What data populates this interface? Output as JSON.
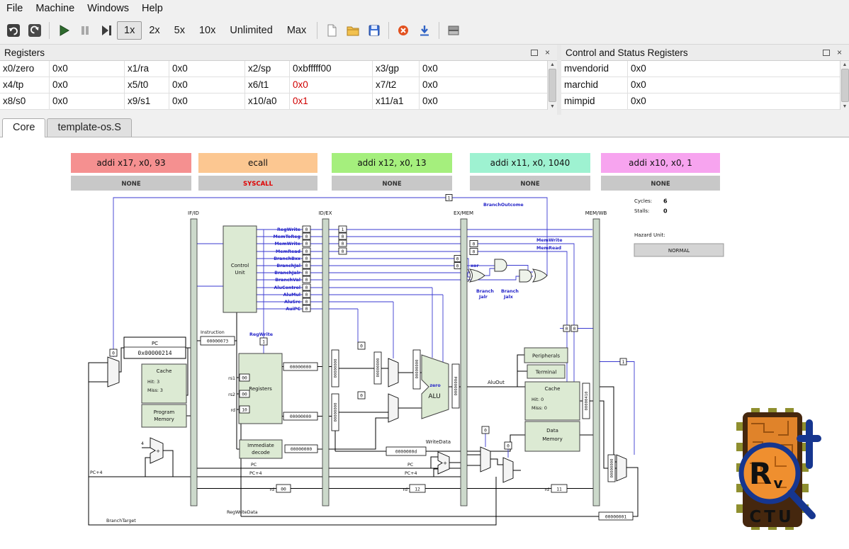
{
  "colors": {
    "accent_blue": "#2626c9",
    "changed_value_red": "#d00000",
    "instr1": "#f59090",
    "instr2": "#fcc791",
    "instr3": "#a5ef7d",
    "instr4": "#9ef2d1",
    "instr5": "#f7a4ef",
    "status_bar_gray": "#c8c8c8",
    "component_green": "#dcead3"
  },
  "menubar": {
    "items": {
      "file": "File",
      "machine": "Machine",
      "windows": "Windows",
      "help": "Help"
    }
  },
  "toolbar": {
    "speeds": {
      "s1": "1x",
      "s2": "2x",
      "s3": "5x",
      "s4": "10x",
      "s5": "Unlimited",
      "s6": "Max"
    },
    "icons": {
      "reset": "reset-icon",
      "reload": "reload-icon",
      "play": "play-icon",
      "pause": "pause-icon",
      "step": "step-icon",
      "new_file": "new-file-icon",
      "open": "open-folder-icon",
      "save": "save-icon",
      "close_sim": "close-icon",
      "fetch": "download-icon",
      "memory": "package-icon"
    }
  },
  "registers_panel": {
    "title": "Registers",
    "rows": [
      [
        "x0/zero",
        "0x0",
        "x1/ra",
        "0x0",
        "x2/sp",
        "0xbfffff00",
        "x3/gp",
        "0x0"
      ],
      [
        "x4/tp",
        "0x0",
        "x5/t0",
        "0x0",
        "x6/t1",
        "0x0",
        "x7/t2",
        "0x0"
      ],
      [
        "x8/s0",
        "0x0",
        "x9/s1",
        "0x0",
        "x10/a0",
        "0x1",
        "x11/a1",
        "0x0"
      ]
    ]
  },
  "csr_panel": {
    "title": "Control and Status Registers",
    "rows": [
      [
        "mvendorid",
        "0x0"
      ],
      [
        "marchid",
        "0x0"
      ],
      [
        "mimpid",
        "0x0"
      ]
    ]
  },
  "tabs": {
    "core": "Core",
    "source": "template-os.S"
  },
  "core": {
    "instructions": [
      {
        "text": "addi x17, x0, 93",
        "status": "NONE"
      },
      {
        "text": "ecall",
        "status": "SYSCALL"
      },
      {
        "text": "addi x12, x0, 13",
        "status": "NONE"
      },
      {
        "text": "addi x11, x0, 1040",
        "status": "NONE"
      },
      {
        "text": "addi x10, x0, 1",
        "status": "NONE"
      }
    ],
    "stages": [
      "IF/ID",
      "ID/EX",
      "EX/MEM",
      "MEM/WB"
    ],
    "signals": [
      "RegWrite",
      "MemToReg",
      "MemWrite",
      "MemRead",
      "BranchBxx",
      "BranchJal",
      "BranchJalr",
      "BranchVal",
      "AluControl",
      "AluMul",
      "AluSrc",
      "AuiPC"
    ],
    "signal_values": [
      "0",
      "0",
      "0",
      "0",
      "0",
      "0",
      "0",
      "0",
      "0",
      "0",
      "0",
      "0"
    ],
    "signal_values2": [
      "1",
      "0",
      "0",
      "0"
    ],
    "control_unit": {
      "line1": "Control",
      "line2": "Unit"
    },
    "pc": {
      "label": "PC",
      "value": "0x00000214"
    },
    "instruction": {
      "label": "Instruction",
      "value": "00000073"
    },
    "regwrite": {
      "label": "RegWrite",
      "value": "1"
    },
    "registers_block": {
      "label": "Registers",
      "rs1": "rs1",
      "rs1_value": "00",
      "rs2": "rs2",
      "rs2_value": "00",
      "rd": "rd",
      "rd_value": "10",
      "out_a": "00000000",
      "out_b": "00000000"
    },
    "program_cache": {
      "title": "Cache",
      "hit": "Hit:  3",
      "miss": "Miss:  3"
    },
    "program_memory": {
      "line1": "Program",
      "line2": "Memory"
    },
    "immediate": {
      "line1": "Immediate",
      "line2": "decode",
      "value": "00000000"
    },
    "alu": {
      "zero": "zero",
      "label": "ALU"
    },
    "alu_out_label": "AluOut",
    "write_data": {
      "label": "WriteData",
      "value": "0000000d"
    },
    "peripherals": "Peripherals",
    "terminal": "Terminal",
    "data_cache": {
      "title": "Cache",
      "hit": "Hit:  0",
      "miss": "Miss:  0"
    },
    "data_memory": {
      "line1": "Data",
      "line2": "Memory"
    },
    "branch": {
      "xor": "xor",
      "jalr_line1": "Branch",
      "jalr_line2": "Jalr",
      "jalx_line1": "Branch",
      "jalx_line2": "Jalx",
      "outcome": "BranchOutcome",
      "one": "1",
      "memwrite": "MemWrite",
      "memread": "MemRead",
      "b1": "0",
      "b2": "0"
    },
    "stats": {
      "cycles_label": "Cycles:",
      "cycles_value": "6",
      "stalls_label": "Stalls:",
      "stalls_value": "0"
    },
    "hazard": {
      "label": "Hazard Unit:",
      "value": "NORMAL"
    },
    "vboxes": {
      "a": "00000000",
      "b": "00000000",
      "c": "00000000",
      "d": "00000000",
      "e": "0000000d",
      "f": "00000410",
      "g": "00000000"
    },
    "small_boxes": {
      "pcmux": "0",
      "mux1": "0",
      "mux2": "0",
      "mux3": "0",
      "mux4": "0",
      "wb1": "0",
      "wb2": "0",
      "wb3": "1",
      "exw": "0",
      "exr": "0"
    },
    "bottom": {
      "pc_a": "PC",
      "pc4_a": "PC+4",
      "pc_b": "PC",
      "pc4_b": "PC+4",
      "pc4_left": "PC+4",
      "branch_target": "BranchTarget",
      "reg_write_data": "RegWriteData",
      "rd1_label": "rd",
      "rd1": "00",
      "rd2_label": "rd",
      "rd2": "12",
      "rd3_label": "rd",
      "rd3": "11",
      "wb_value": "00000001",
      "four": "4",
      "plus_a": "+",
      "plus_b": "+"
    }
  },
  "logo": {
    "r": "R",
    "v": "v",
    "ctu": "CTU"
  }
}
